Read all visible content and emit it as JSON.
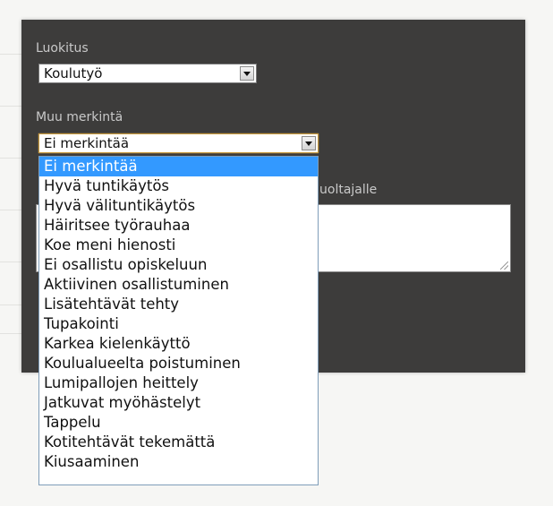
{
  "classification": {
    "label": "Luokitus",
    "selected": "Koulutyö"
  },
  "other_mark": {
    "label": "Muu merkintä",
    "selected": "Ei merkintää",
    "options": [
      "Ei merkintää",
      "Hyvä tuntikäytös",
      "Hyvä välituntikäytös",
      "Häiritsee työrauhaa",
      "Koe meni hienosti",
      "Ei osallistu opiskeluun",
      "Aktiivinen osallistuminen",
      "Lisätehtävät tehty",
      "Tupakointi",
      "Karkea kielenkäyttö",
      "Koulualueelta poistuminen",
      "Lumipallojen heittely",
      "Jatkuvat myöhästelyt",
      "Tappelu",
      "Kotitehtävät tekemättä",
      "Kiusaaminen"
    ]
  },
  "message": {
    "partial_label": "uoltajalle"
  },
  "colors": {
    "panel": "#3d3c3b",
    "highlight": "#3399ff",
    "label": "#c9c9c9"
  }
}
